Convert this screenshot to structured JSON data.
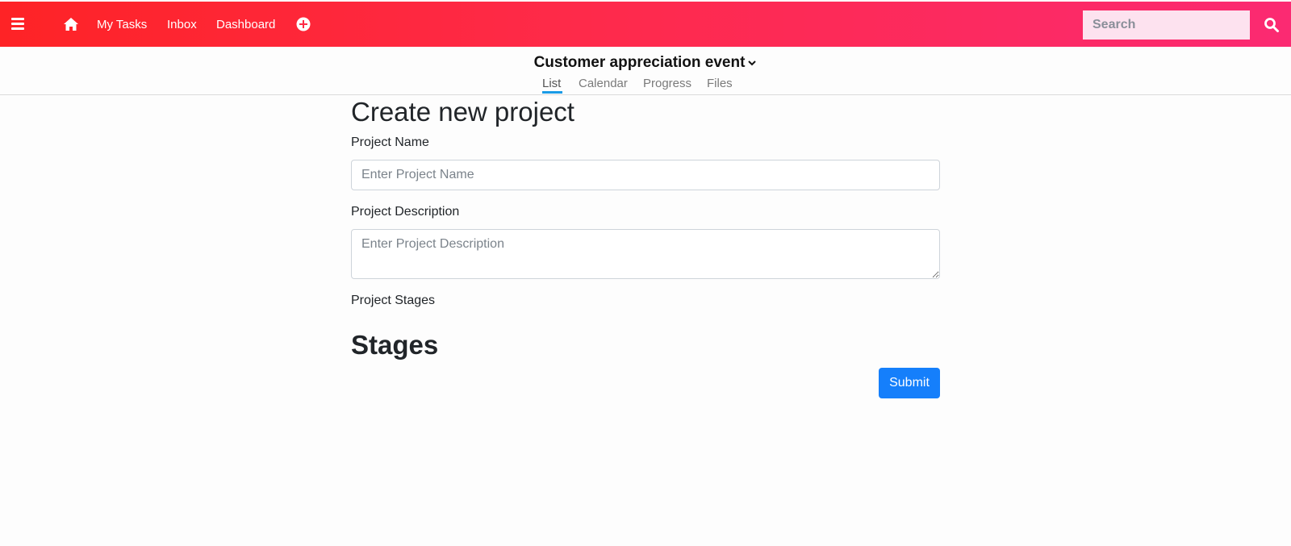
{
  "nav": {
    "links": [
      "My Tasks",
      "Inbox",
      "Dashboard"
    ],
    "search_placeholder": "Search",
    "icons": {
      "menu": "hamburger-icon",
      "home": "home-icon",
      "add": "plus-circle-icon",
      "search": "search-icon"
    },
    "gradient": [
      "#fe2326",
      "#fb2a72"
    ]
  },
  "project": {
    "title": "Customer appreciation event",
    "tabs": [
      "List",
      "Calendar",
      "Progress",
      "Files"
    ],
    "active_tab": "List",
    "accent": "#1a9be6"
  },
  "form": {
    "heading": "Create new project",
    "name_label": "Project Name",
    "name_placeholder": "Enter Project Name",
    "description_label": "Project Description",
    "description_placeholder": "Enter Project Description",
    "stages_label": "Project Stages",
    "stages_heading": "Stages",
    "submit_label": "Submit",
    "submit_color": "#157ffb"
  }
}
